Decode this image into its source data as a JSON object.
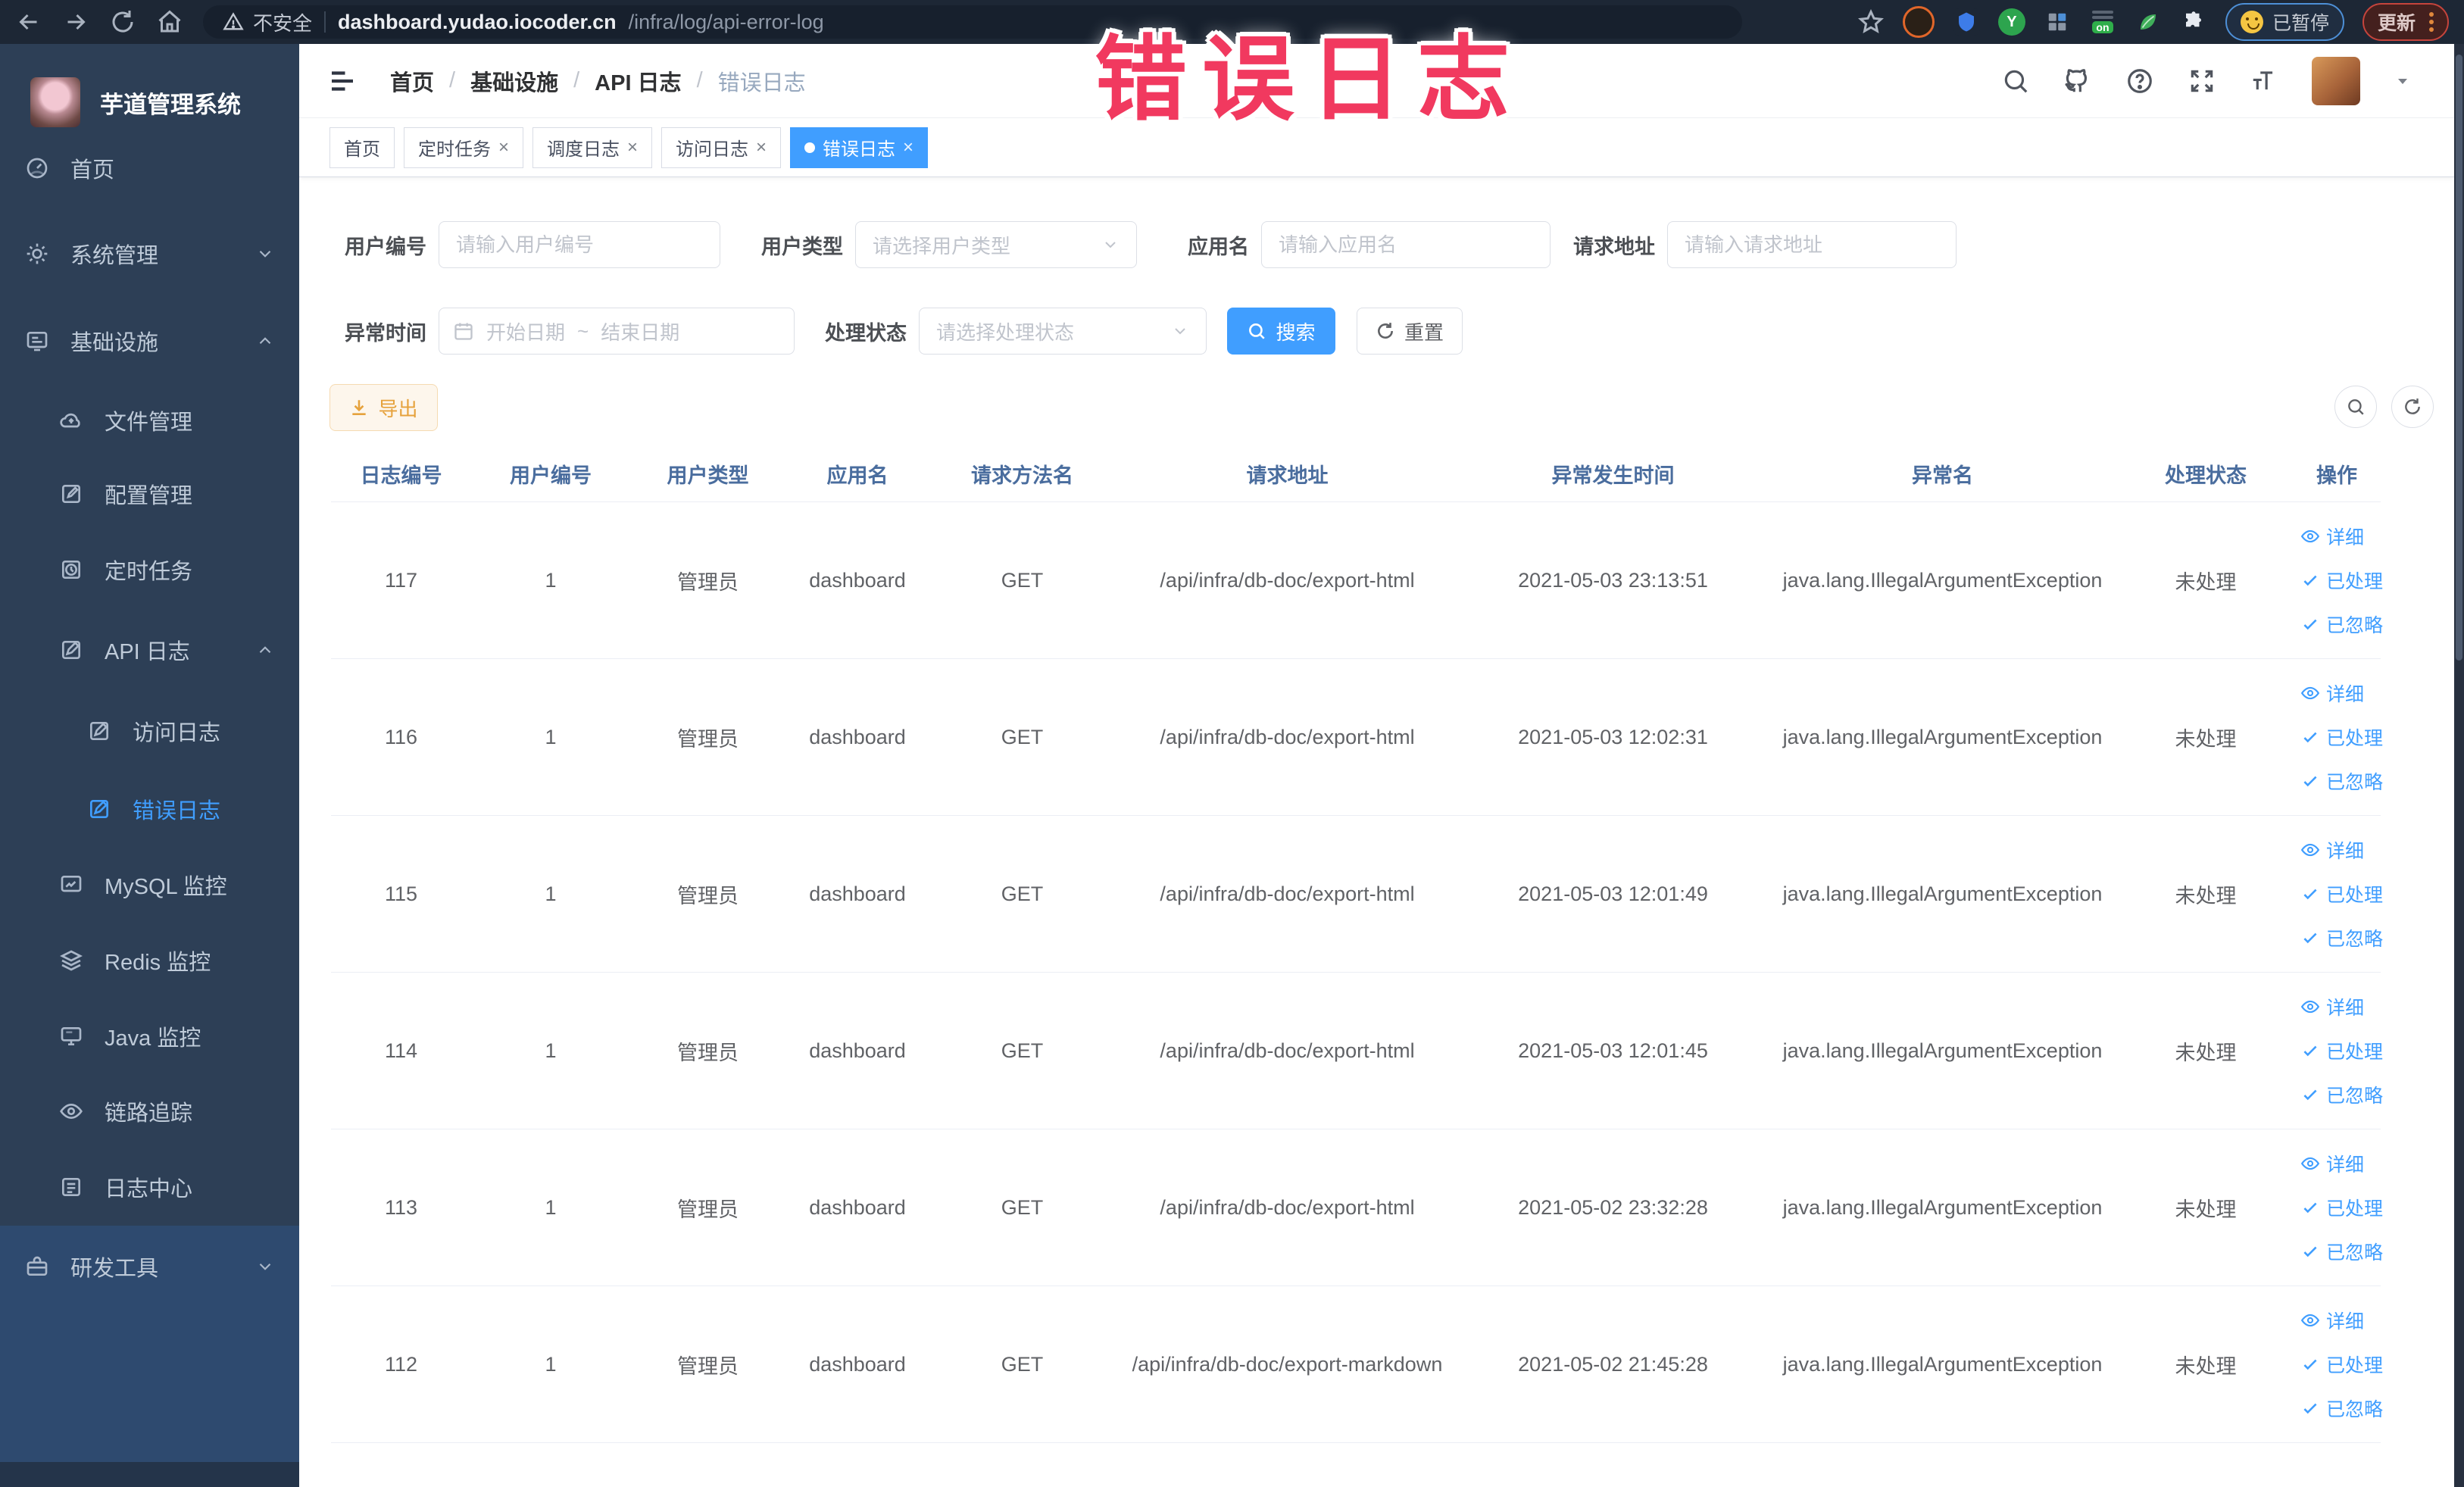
{
  "browser": {
    "security_label": "不安全",
    "url_host": "dashboard.yudao.iocoder.cn",
    "url_path": "/infra/log/api-error-log",
    "ext_switch_text": "on",
    "paused_label": "已暂停",
    "update_label": "更新"
  },
  "annotation": {
    "text": "错误日志",
    "color": "#f1395f"
  },
  "sidebar": {
    "title": "芋道管理系统",
    "items": [
      {
        "label": "首页"
      },
      {
        "label": "系统管理"
      },
      {
        "label": "基础设施"
      },
      {
        "label": "文件管理"
      },
      {
        "label": "配置管理"
      },
      {
        "label": "定时任务"
      },
      {
        "label": "API 日志"
      },
      {
        "label": "访问日志"
      },
      {
        "label": "错误日志"
      },
      {
        "label": "MySQL 监控"
      },
      {
        "label": "Redis 监控"
      },
      {
        "label": "Java 监控"
      },
      {
        "label": "链路追踪"
      },
      {
        "label": "日志中心"
      },
      {
        "label": "研发工具"
      }
    ]
  },
  "header": {
    "breadcrumb": [
      "首页",
      "基础设施",
      "API 日志",
      "错误日志"
    ]
  },
  "tabs": [
    {
      "label": "首页"
    },
    {
      "label": "定时任务"
    },
    {
      "label": "调度日志"
    },
    {
      "label": "访问日志"
    },
    {
      "label": "错误日志"
    }
  ],
  "filters": {
    "user_id_label": "用户编号",
    "user_id_placeholder": "请输入用户编号",
    "user_type_label": "用户类型",
    "user_type_placeholder": "请选择用户类型",
    "app_name_label": "应用名",
    "app_name_placeholder": "请输入应用名",
    "request_url_label": "请求地址",
    "request_url_placeholder": "请输入请求地址",
    "exception_time_label": "异常时间",
    "date_start_placeholder": "开始日期",
    "date_separator": "~",
    "date_end_placeholder": "结束日期",
    "process_status_label": "处理状态",
    "process_status_placeholder": "请选择处理状态",
    "search_label": "搜索",
    "reset_label": "重置"
  },
  "toolbar": {
    "export_label": "导出"
  },
  "table": {
    "columns": [
      "日志编号",
      "用户编号",
      "用户类型",
      "应用名",
      "请求方法名",
      "请求地址",
      "异常发生时间",
      "异常名",
      "处理状态",
      "操作"
    ],
    "action_labels": {
      "detail": "详细",
      "processed": "已处理",
      "ignored": "已忽略"
    },
    "rows": [
      {
        "id": "117",
        "user_id": "1",
        "user_type": "管理员",
        "app": "dashboard",
        "method": "GET",
        "url": "/api/infra/db-doc/export-html",
        "time": "2021-05-03 23:13:51",
        "exception": "java.lang.IllegalArgumentException",
        "status": "未处理"
      },
      {
        "id": "116",
        "user_id": "1",
        "user_type": "管理员",
        "app": "dashboard",
        "method": "GET",
        "url": "/api/infra/db-doc/export-html",
        "time": "2021-05-03 12:02:31",
        "exception": "java.lang.IllegalArgumentException",
        "status": "未处理"
      },
      {
        "id": "115",
        "user_id": "1",
        "user_type": "管理员",
        "app": "dashboard",
        "method": "GET",
        "url": "/api/infra/db-doc/export-html",
        "time": "2021-05-03 12:01:49",
        "exception": "java.lang.IllegalArgumentException",
        "status": "未处理"
      },
      {
        "id": "114",
        "user_id": "1",
        "user_type": "管理员",
        "app": "dashboard",
        "method": "GET",
        "url": "/api/infra/db-doc/export-html",
        "time": "2021-05-03 12:01:45",
        "exception": "java.lang.IllegalArgumentException",
        "status": "未处理"
      },
      {
        "id": "113",
        "user_id": "1",
        "user_type": "管理员",
        "app": "dashboard",
        "method": "GET",
        "url": "/api/infra/db-doc/export-html",
        "time": "2021-05-02 23:32:28",
        "exception": "java.lang.IllegalArgumentException",
        "status": "未处理"
      },
      {
        "id": "112",
        "user_id": "1",
        "user_type": "管理员",
        "app": "dashboard",
        "method": "GET",
        "url": "/api/infra/db-doc/export-markdown",
        "time": "2021-05-02 21:45:28",
        "exception": "java.lang.IllegalArgumentException",
        "status": "未处理"
      }
    ]
  },
  "colors": {
    "accent": "#409eff",
    "warning": "#e6a23c",
    "sidebar_bg": "#2d3f56",
    "topbar_bg": "#1d2735"
  }
}
